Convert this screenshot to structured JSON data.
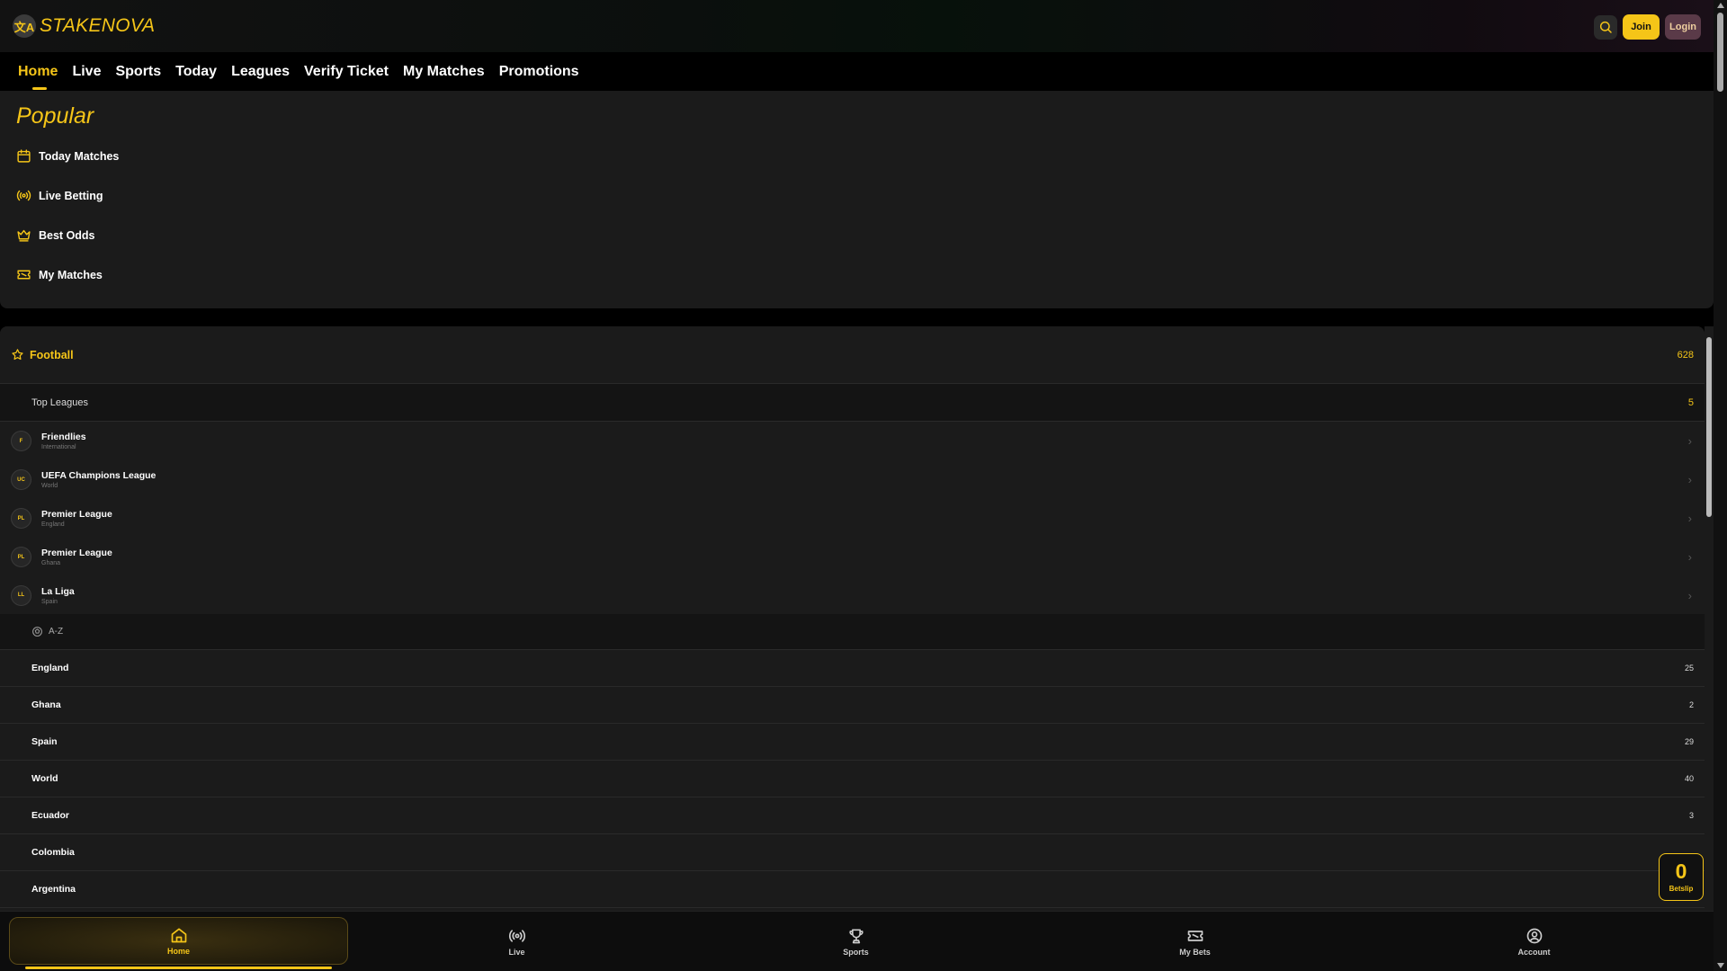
{
  "header": {
    "logo_glyph": "文A",
    "brand": "STAKENOVA",
    "join_label": "Join",
    "login_label": "Login",
    "accent_color": "#f5c518"
  },
  "nav": {
    "items": [
      "Home",
      "Live",
      "Sports",
      "Today",
      "Leagues",
      "Verify Ticket",
      "My Matches",
      "Promotions"
    ],
    "active": "Home"
  },
  "popular": {
    "title": "Popular",
    "items": [
      {
        "label": "Today Matches",
        "icon": "calendar-icon"
      },
      {
        "label": "Live Betting",
        "icon": "broadcast-icon"
      },
      {
        "label": "Best Odds",
        "icon": "crown-icon"
      },
      {
        "label": "My Matches",
        "icon": "ticket-icon"
      }
    ]
  },
  "sports": {
    "football": {
      "label": "Football",
      "count": "628"
    },
    "top_leagues": {
      "label": "Top Leagues",
      "count": "5"
    },
    "leagues": [
      {
        "abbr": "F",
        "name": "Friendlies",
        "country": "International"
      },
      {
        "abbr": "UC",
        "name": "UEFA Champions League",
        "country": "World"
      },
      {
        "abbr": "PL",
        "name": "Premier League",
        "country": "England"
      },
      {
        "abbr": "PL",
        "name": "Premier League",
        "country": "Ghana"
      },
      {
        "abbr": "LL",
        "name": "La Liga",
        "country": "Spain"
      }
    ],
    "az_label": "A-Z",
    "countries": [
      {
        "name": "England",
        "count": "25"
      },
      {
        "name": "Ghana",
        "count": "2"
      },
      {
        "name": "Spain",
        "count": "29"
      },
      {
        "name": "World",
        "count": "40"
      },
      {
        "name": "Ecuador",
        "count": "3"
      },
      {
        "name": "Colombia",
        "count": ""
      },
      {
        "name": "Argentina",
        "count": ""
      }
    ]
  },
  "betslip": {
    "count": "0",
    "label": "Betslip"
  },
  "bottom_nav": {
    "items": [
      {
        "label": "Home",
        "icon": "home-icon"
      },
      {
        "label": "Live",
        "icon": "broadcast-icon"
      },
      {
        "label": "Sports",
        "icon": "trophy-icon"
      },
      {
        "label": "My Bets",
        "icon": "ticket-icon"
      },
      {
        "label": "Account",
        "icon": "user-circle-icon"
      }
    ],
    "active": "Home"
  }
}
